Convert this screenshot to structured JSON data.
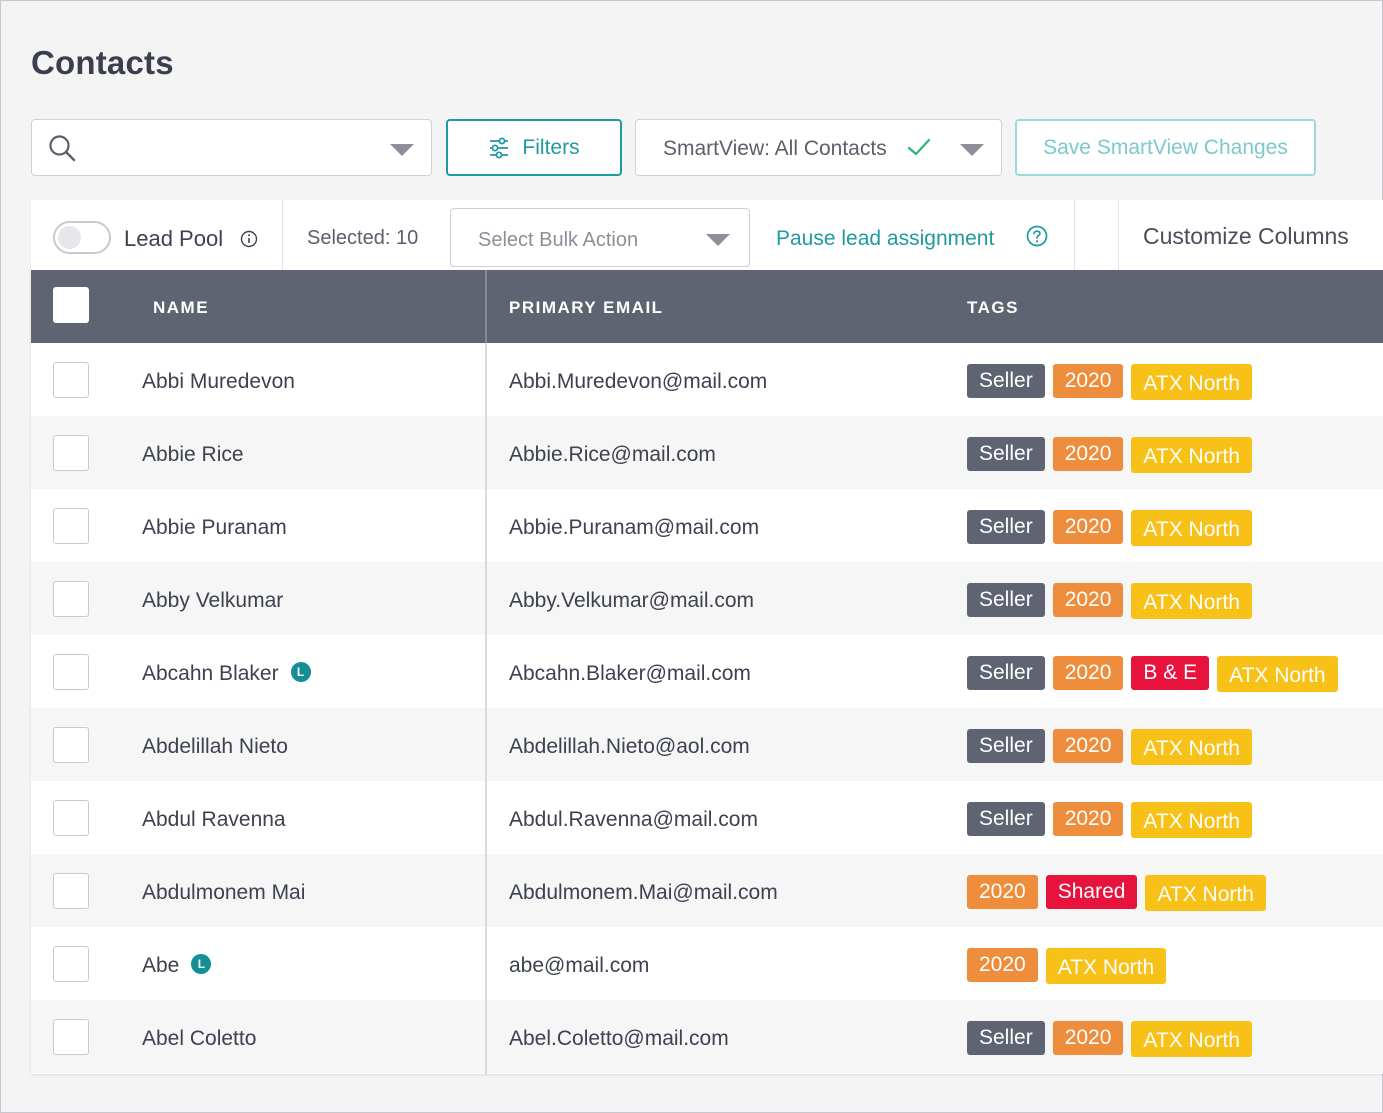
{
  "page_title": "Contacts",
  "search": {
    "placeholder": "",
    "value": ""
  },
  "toolbar": {
    "filters_label": "Filters",
    "smartview_label": "SmartView: All Contacts",
    "save_smartview_label": "Save SmartView Changes"
  },
  "action_bar": {
    "lead_pool_label": "Lead Pool",
    "lead_pool_enabled": false,
    "selected_text": "Selected: 10",
    "bulk_action_placeholder": "Select Bulk Action",
    "pause_link": "Pause lead assignment",
    "customize_columns": "Customize Columns"
  },
  "table": {
    "headers": {
      "name": "NAME",
      "email": "PRIMARY EMAIL",
      "tags": "TAGS"
    },
    "rows": [
      {
        "name": "Abbi Muredevon",
        "lead_badge": "",
        "email": "Abbi.Muredevon@mail.com",
        "tags": [
          "Seller",
          "2020",
          "ATX North"
        ]
      },
      {
        "name": "Abbie Rice",
        "lead_badge": "",
        "email": "Abbie.Rice@mail.com",
        "tags": [
          "Seller",
          "2020",
          "ATX North"
        ]
      },
      {
        "name": "Abbie Puranam",
        "lead_badge": "",
        "email": "Abbie.Puranam@mail.com",
        "tags": [
          "Seller",
          "2020",
          "ATX North"
        ]
      },
      {
        "name": "Abby Velkumar",
        "lead_badge": "",
        "email": "Abby.Velkumar@mail.com",
        "tags": [
          "Seller",
          "2020",
          "ATX North"
        ]
      },
      {
        "name": "Abcahn Blaker",
        "lead_badge": "L",
        "email": "Abcahn.Blaker@mail.com",
        "tags": [
          "Seller",
          "2020",
          "B & E",
          "ATX North"
        ]
      },
      {
        "name": "Abdelillah Nieto",
        "lead_badge": "",
        "email": "Abdelillah.Nieto@aol.com",
        "tags": [
          "Seller",
          "2020",
          "ATX North"
        ]
      },
      {
        "name": "Abdul Ravenna",
        "lead_badge": "",
        "email": "Abdul.Ravenna@mail.com",
        "tags": [
          "Seller",
          "2020",
          "ATX North"
        ]
      },
      {
        "name": "Abdulmonem Mai",
        "lead_badge": "",
        "email": "Abdulmonem.Mai@mail.com",
        "tags": [
          "2020",
          "Shared",
          "ATX North"
        ]
      },
      {
        "name": "Abe",
        "lead_badge": "L",
        "email": "abe@mail.com",
        "tags": [
          "2020",
          "ATX North"
        ]
      },
      {
        "name": "Abel Coletto",
        "lead_badge": "",
        "email": "Abel.Coletto@mail.com",
        "tags": [
          "Seller",
          "2020",
          "ATX North"
        ]
      }
    ]
  },
  "colors": {
    "accent": "#1f9aa0",
    "header_bg": "#5f6473",
    "tag_seller": "#5f6473",
    "tag_2020": "#ee8d3c",
    "tag_atx_north": "#f7c117",
    "tag_red": "#e8133c"
  },
  "icons": [
    "search-icon",
    "chevron-down-icon",
    "filters-icon",
    "check-icon",
    "info-icon",
    "help-icon"
  ]
}
